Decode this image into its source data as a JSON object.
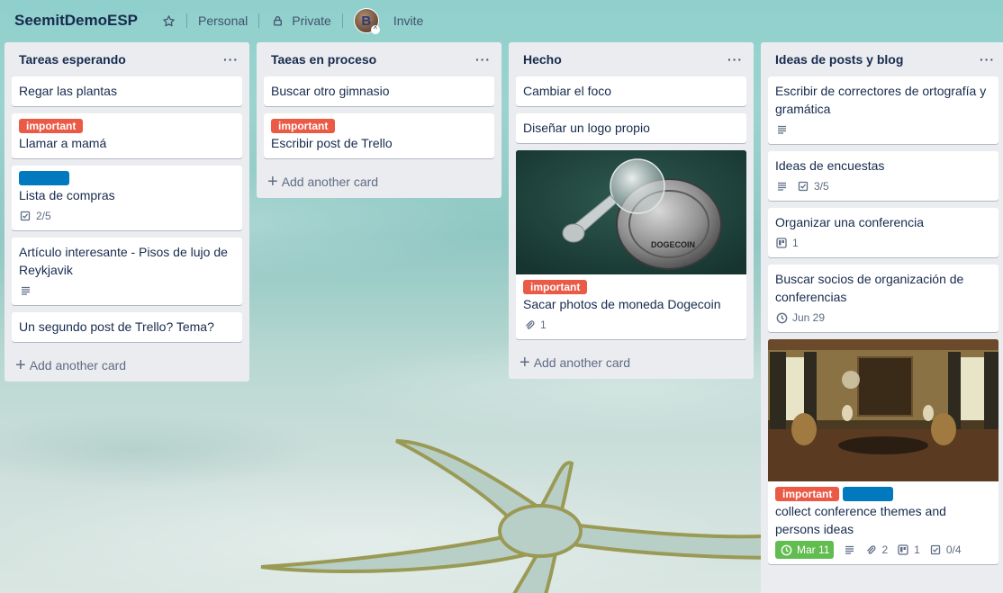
{
  "board": {
    "title": "SeemitDemoESP",
    "visibility_team": "Personal",
    "visibility": "Private",
    "avatar_letter": "B",
    "invite": "Invite"
  },
  "icons": {
    "star": "star-icon",
    "lock": "lock-icon",
    "menu": "more-horizontal-icon",
    "description": "description-icon",
    "checklist": "checklist-icon",
    "attachment": "paperclip-icon",
    "clock": "clock-icon",
    "trello": "trello-board-icon"
  },
  "colors": {
    "label_red": "#eb5a46",
    "label_blue": "#0079bf",
    "due_green": "#61bd4f",
    "list_bg": "#ebecf0"
  },
  "lists": [
    {
      "title": "Tareas esperando",
      "menu": "···",
      "cards": [
        {
          "title": "Regar las plantas"
        },
        {
          "label_red": "important",
          "title": "Llamar a mamá"
        },
        {
          "title": "Lista de compras",
          "checklist": "2/5"
        },
        {
          "title": "Artículo interesante - Pisos de lujo de Reykjavik"
        },
        {
          "title": "Un segundo post de Trello? Tema?"
        }
      ],
      "add": "Add another card"
    },
    {
      "title": "Taeas en proceso",
      "menu": "···",
      "cards": [
        {
          "title": "Buscar otro gimnasio"
        },
        {
          "label_red": "important",
          "title": "Escribir post de Trello"
        }
      ],
      "add": "Add another card"
    },
    {
      "title": "Hecho",
      "menu": "···",
      "cards": [
        {
          "title": "Cambiar el foco"
        },
        {
          "title": "Diseñar un logo propio"
        },
        {
          "label_red": "important",
          "title": "Sacar photos de moneda Dogecoin",
          "attachments": "1",
          "coin_text": "DOGECOIN"
        }
      ],
      "add": "Add another card"
    },
    {
      "title": "Ideas de posts y blog",
      "menu": "···",
      "cards": [
        {
          "title": "Escribir de correctores de ortografía y gramática"
        },
        {
          "title": "Ideas de encuestas",
          "checklist": "3/5"
        },
        {
          "title": "Organizar una conferencia",
          "boards": "1"
        },
        {
          "title": "Buscar socios de organización de conferencias",
          "due": "Jun 29"
        },
        {
          "label_red": "important",
          "title": "collect conference themes and persons ideas",
          "due": "Mar 11",
          "attachments": "2",
          "boards": "1",
          "checklist": "0/4"
        }
      ]
    }
  ]
}
